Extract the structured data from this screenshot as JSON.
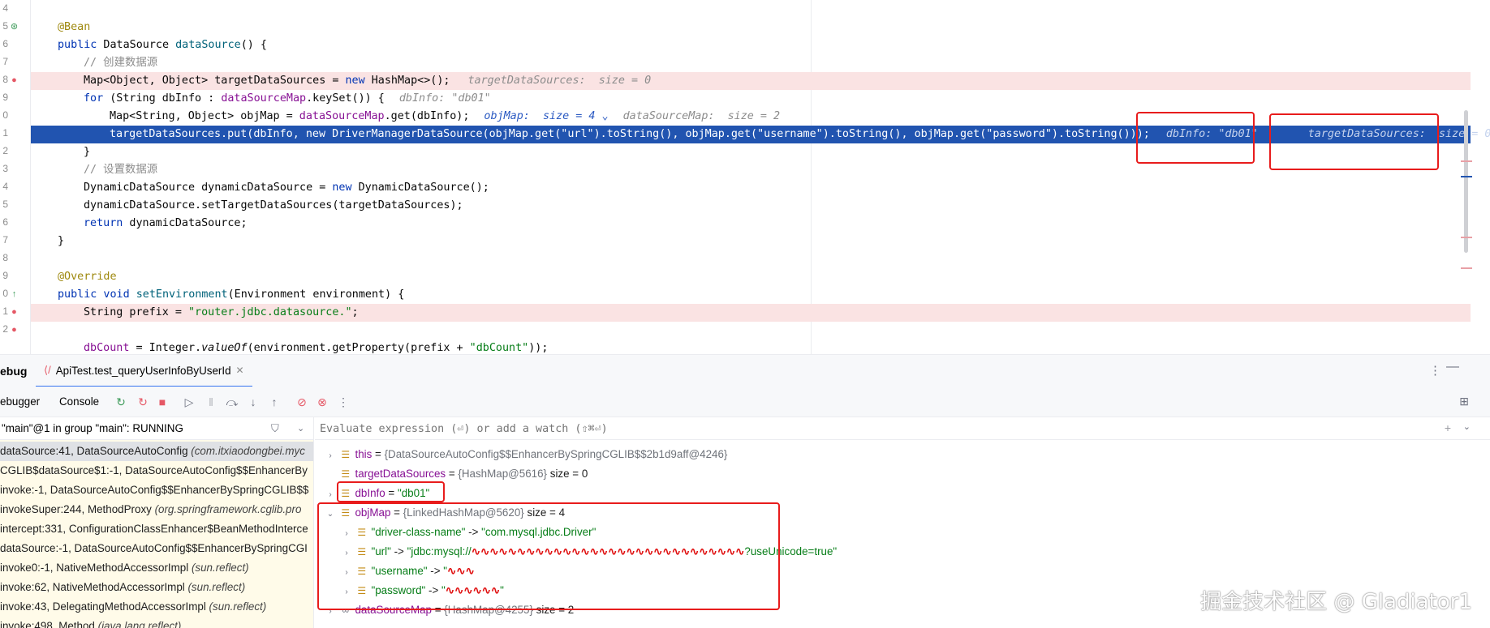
{
  "editor": {
    "line_numbers": [
      "4",
      "5",
      "6",
      "7",
      "8",
      "9",
      "0",
      "1",
      "2",
      "3",
      "4",
      "5",
      "6",
      "7",
      "8",
      "9",
      "0",
      "1",
      "2"
    ],
    "hints": {
      "target_size": "targetDataSources:  size = 0",
      "dbinfo": "dbInfo: \"db01\"",
      "objmap": "objMap:  size = 4",
      "datasourcemap": "dataSourceMap:  size = 2",
      "cur_dbinfo": "dbInfo: \"db01\"",
      "cur_target": "targetDataSources:  size = 0"
    },
    "lines": {
      "ann_bean": "@Bean",
      "l_public": "public",
      "l_ds_type": " DataSource ",
      "l_ds_method": "dataSource",
      "l_ds_rest": "() {",
      "comment1": "// 创建数据源",
      "map_decl": "Map<Object, Object> targetDataSources = ",
      "kw_new": "new",
      "hashmap": " HashMap<>();",
      "kw_for": "for",
      "for_a": " (String dbInfo : ",
      "for_field": "dataSourceMap",
      "for_b": ".keySet()) {",
      "objmap_a": "Map<String, Object> objMap = ",
      "objmap_field": "dataSourceMap",
      "objmap_b": ".get(dbInfo);",
      "put_line": "targetDataSources.put(dbInfo, new DriverManagerDataSource(objMap.get(\"url\").toString(), objMap.get(\"username\").toString(), objMap.get(\"password\").toString()));",
      "close_brace": "}",
      "comment2": "// 设置数据源",
      "dyn_a": "DynamicDataSource dynamicDataSource = ",
      "dyn_b": " DynamicDataSource();",
      "set_target": "dynamicDataSource.setTargetDataSources(targetDataSources);",
      "kw_return": "return",
      "return_rest": " dynamicDataSource;",
      "ann_override": "@Override",
      "pub_void": "public void ",
      "set_env": "setEnvironment",
      "set_env_rest": "(Environment environment) {",
      "prefix_a": "String prefix = ",
      "prefix_str": "\"router.jdbc.datasource.\"",
      "prefix_b": ";",
      "dbcount_field": "dbCount",
      "dbcount_a": " = Integer.",
      "dbcount_value_of": "valueOf",
      "dbcount_b": "(environment.getProperty(prefix + ",
      "dbcount_str": "\"dbCount\"",
      "dbcount_c": "));"
    }
  },
  "debug": {
    "panel_title": "ebug",
    "run_tab": "ApiTest.test_queryUserInfoByUserId",
    "subtabs": {
      "debugger": "ebugger",
      "console": "Console"
    },
    "thread": "\"main\"@1 in group \"main\": RUNNING",
    "eval_placeholder": "Evaluate expression (⏎) or add a watch (⇧⌘⏎)",
    "frames": [
      {
        "loc": "dataSource:41, DataSourceAutoConfig ",
        "pkg": "(com.itxiaodongbei.myc"
      },
      {
        "loc": "CGLIB$dataSource$1:-1, DataSourceAutoConfig$$EnhancerBy",
        "pkg": ""
      },
      {
        "loc": "invoke:-1, DataSourceAutoConfig$$EnhancerBySpringCGLIB$$",
        "pkg": ""
      },
      {
        "loc": "invokeSuper:244, MethodProxy ",
        "pkg": "(org.springframework.cglib.pro"
      },
      {
        "loc": "intercept:331, ConfigurationClassEnhancer$BeanMethodInterce",
        "pkg": ""
      },
      {
        "loc": "dataSource:-1, DataSourceAutoConfig$$EnhancerBySpringCGI",
        "pkg": ""
      },
      {
        "loc": "invoke0:-1, NativeMethodAccessorImpl ",
        "pkg": "(sun.reflect)"
      },
      {
        "loc": "invoke:62, NativeMethodAccessorImpl ",
        "pkg": "(sun.reflect)"
      },
      {
        "loc": "invoke:43, DelegatingMethodAccessorImpl ",
        "pkg": "(sun.reflect)"
      },
      {
        "loc": "invoke:498, Method ",
        "pkg": "(java.lang.reflect)"
      }
    ],
    "variables": {
      "this": {
        "name": "this",
        "eq": " = ",
        "type": "{DataSourceAutoConfig$$EnhancerBySpringCGLIB$$2b1d9aff@4246}"
      },
      "target": {
        "name": "targetDataSources",
        "eq": " = ",
        "type": "{HashMap@5616}",
        "size": "size = 0"
      },
      "dbinfo": {
        "name": "dbInfo",
        "eq": " = ",
        "value": "\"db01\""
      },
      "objmap": {
        "name": "objMap",
        "eq": " = ",
        "type": "{LinkedHashMap@5620}",
        "size": "size = 4"
      },
      "entries": [
        {
          "key": "\"driver-class-name\"",
          "arrow": " -> ",
          "value": "\"com.mysql.jdbc.Driver\""
        },
        {
          "key": "\"url\"",
          "arrow": " -> ",
          "value": "\"jdbc:mysql://",
          "tail": "?useUnicode=true\""
        },
        {
          "key": "\"username\"",
          "arrow": " -> ",
          "value": "\""
        },
        {
          "key": "\"password\"",
          "arrow": " -> ",
          "value": "\"",
          "tail": "\""
        }
      ],
      "dsmap": {
        "name": "dataSourceMap",
        "eq": " = ",
        "type": "{HashMap@4255}",
        "size": "size = 2"
      }
    }
  },
  "watermark": "掘金技术社区 @ Gladiator1"
}
